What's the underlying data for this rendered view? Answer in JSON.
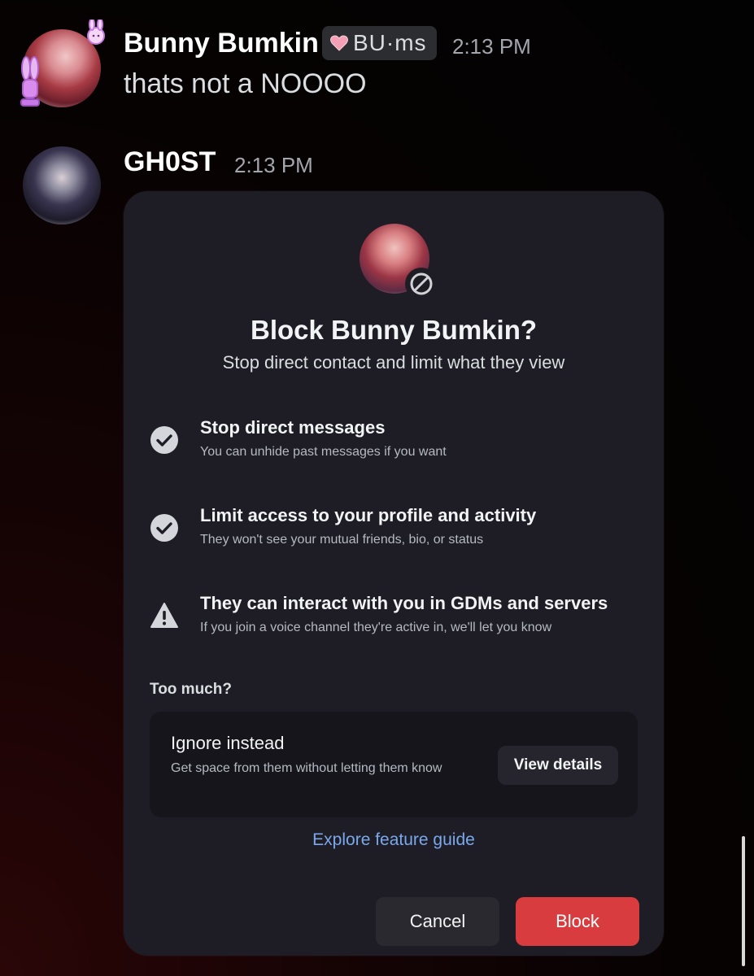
{
  "messages": [
    {
      "username": "Bunny Bumkin",
      "clan_tag": "BU·ms",
      "timestamp": "2:13 PM",
      "text": "thats not a NOOOO"
    },
    {
      "username": "GH0ST",
      "timestamp": "2:13 PM"
    }
  ],
  "modal": {
    "title": "Block Bunny Bumkin?",
    "subtitle": "Stop direct contact and limit what they view",
    "features": [
      {
        "icon": "check-circle-icon",
        "title": "Stop direct messages",
        "description": "You can unhide past messages if you want"
      },
      {
        "icon": "check-circle-icon",
        "title": "Limit access to your profile and activity",
        "description": "They won't see your mutual friends, bio, or status"
      },
      {
        "icon": "warning-triangle-icon",
        "title": "They can interact with you in GDMs and servers",
        "description": "If you join a voice channel they're active in, we'll let you know"
      }
    ],
    "too_much": "Too much?",
    "ignore": {
      "title": "Ignore instead",
      "description": "Get space from them without letting them know",
      "button": "View details"
    },
    "explore_link": "Explore feature guide",
    "cancel_button": "Cancel",
    "block_button": "Block"
  },
  "colors": {
    "block_red": "#d83c3e",
    "link_blue": "#7aa8ec",
    "modal_bg": "#1e1d25"
  }
}
